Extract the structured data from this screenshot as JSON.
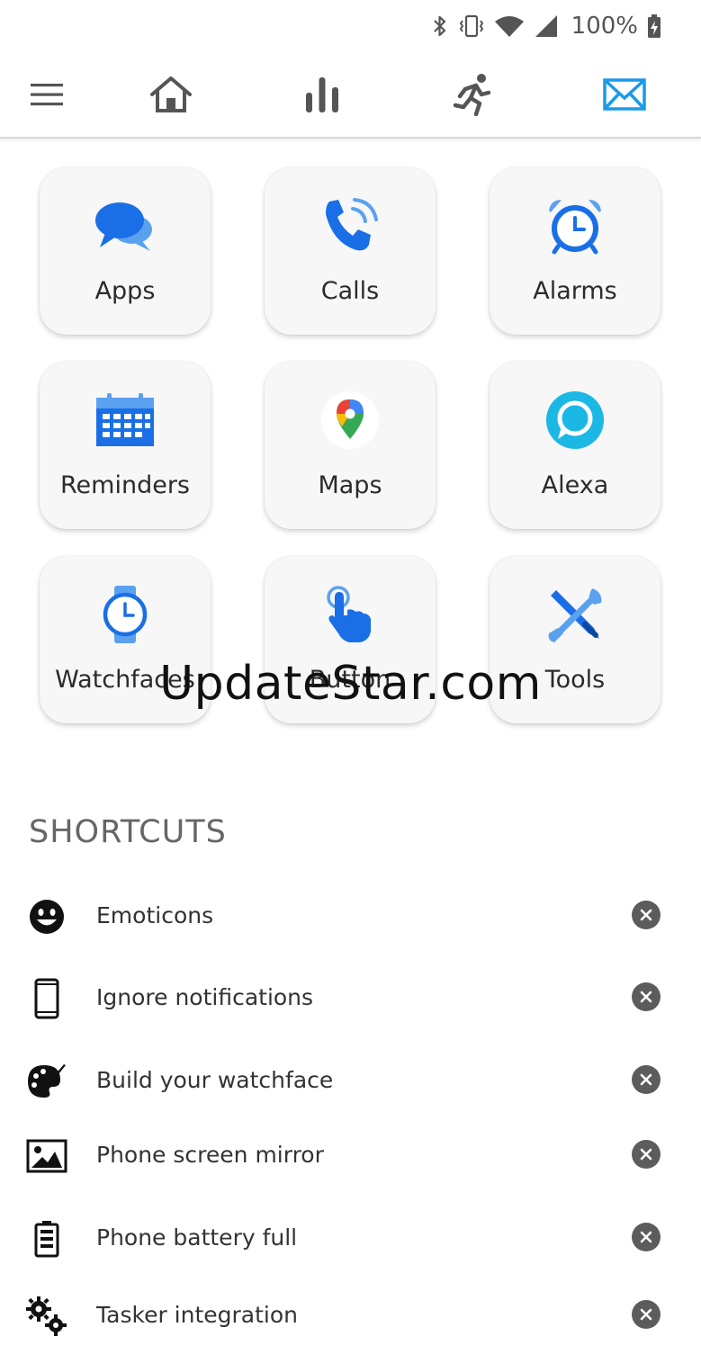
{
  "status_bar": {
    "battery_percent": "100%",
    "icons": [
      "bluetooth-icon",
      "vibrate-icon",
      "wifi-icon",
      "signal-icon",
      "battery-charging-icon"
    ]
  },
  "nav": {
    "items": [
      {
        "icon": "menu-icon"
      },
      {
        "icon": "home-icon"
      },
      {
        "icon": "bar-chart-icon"
      },
      {
        "icon": "running-icon"
      },
      {
        "icon": "mail-icon",
        "active": true
      }
    ],
    "accent": "#1a9ae8"
  },
  "tiles": [
    {
      "label": "Apps",
      "icon": "chat-bubbles-icon"
    },
    {
      "label": "Calls",
      "icon": "phone-ringing-icon"
    },
    {
      "label": "Alarms",
      "icon": "alarm-clock-icon"
    },
    {
      "label": "Reminders",
      "icon": "calendar-icon"
    },
    {
      "label": "Maps",
      "icon": "maps-pin-icon"
    },
    {
      "label": "Alexa",
      "icon": "alexa-icon"
    },
    {
      "label": "Watchfaces",
      "icon": "watch-icon"
    },
    {
      "label": "Button",
      "icon": "tap-hand-icon"
    },
    {
      "label": "Tools",
      "icon": "tools-icon"
    }
  ],
  "watermark": "UpdateStar.com",
  "shortcuts": {
    "title": "SHORTCUTS",
    "items": [
      {
        "label": "Emoticons",
        "icon": "smiley-icon"
      },
      {
        "label": "Ignore notifications",
        "icon": "phone-outline-icon"
      },
      {
        "label": "Build your watchface",
        "icon": "palette-icon"
      },
      {
        "label": "Phone screen mirror",
        "icon": "image-icon"
      },
      {
        "label": "Phone battery full",
        "icon": "battery-icon"
      },
      {
        "label": "Tasker integration",
        "icon": "gears-icon"
      }
    ]
  },
  "colors": {
    "blue": "#1a73e8",
    "alexa": "#1bb8e6",
    "remove_button": "#5c5c5c"
  }
}
